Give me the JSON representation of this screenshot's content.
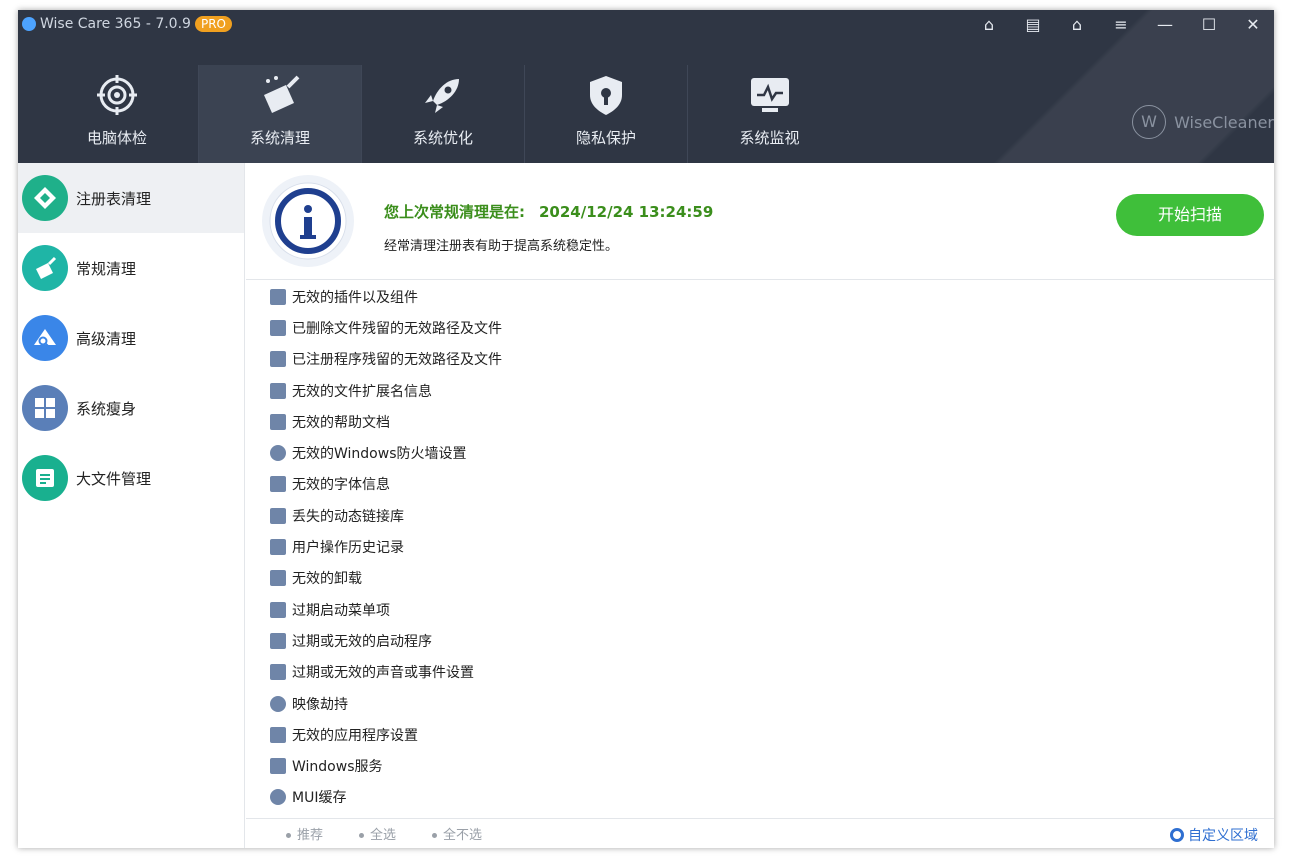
{
  "window": {
    "app_title": "Wise Care 365 - 7.0.9",
    "edition_badge": "PRO",
    "controls": [
      "⌂",
      "▤",
      "⌂",
      "≡",
      "—",
      "☐",
      "✕"
    ]
  },
  "nav": {
    "items": [
      {
        "label": "电脑体检",
        "icon": "crosshair-icon"
      },
      {
        "label": "系统清理",
        "icon": "broom-icon"
      },
      {
        "label": "系统优化",
        "icon": "rocket-icon"
      },
      {
        "label": "隐私保护",
        "icon": "shield-lock-icon"
      },
      {
        "label": "系统监视",
        "icon": "monitor-icon"
      }
    ],
    "active": "系统清理"
  },
  "brand": {
    "mark": "W",
    "name": "WiseCleaner"
  },
  "sidebar": {
    "items": [
      {
        "label": "注册表清理",
        "icon": "registry-icon",
        "color": "#1fb08a"
      },
      {
        "label": "常规清理",
        "icon": "broom-icon",
        "color": "#1fb5a6"
      },
      {
        "label": "高级清理",
        "icon": "magnifier-icon",
        "color": "#3a86e8"
      },
      {
        "label": "系统瘦身",
        "icon": "windows-icon",
        "color": "#5a7fb8"
      },
      {
        "label": "大文件管理",
        "icon": "file-list-icon",
        "color": "#19b08f"
      }
    ],
    "active": "注册表清理"
  },
  "info": {
    "title_prefix": "您上次常规清理是在:",
    "timestamp": "2024/12/24 13:24:59",
    "subtitle": "经常清理注册表有助于提高系统稳定性。",
    "scan_button": "开始扫描",
    "accent": "#3fbf3a"
  },
  "items": [
    "无效的插件以及组件",
    "已删除文件残留的无效路径及文件",
    "已注册程序残留的无效路径及文件",
    "无效的文件扩展名信息",
    "无效的帮助文档",
    "无效的Windows防火墙设置",
    "无效的字体信息",
    "丢失的动态链接库",
    "用户操作历史记录",
    "无效的卸载",
    "过期启动菜单项",
    "过期或无效的启动程序",
    "过期或无效的声音或事件设置",
    "映像劫持",
    "无效的应用程序设置",
    "Windows服务",
    "MUI缓存"
  ],
  "footer": {
    "recommend": "推荐",
    "select_all": "全选",
    "select_none": "全不选",
    "custom_area": "自定义区域"
  }
}
